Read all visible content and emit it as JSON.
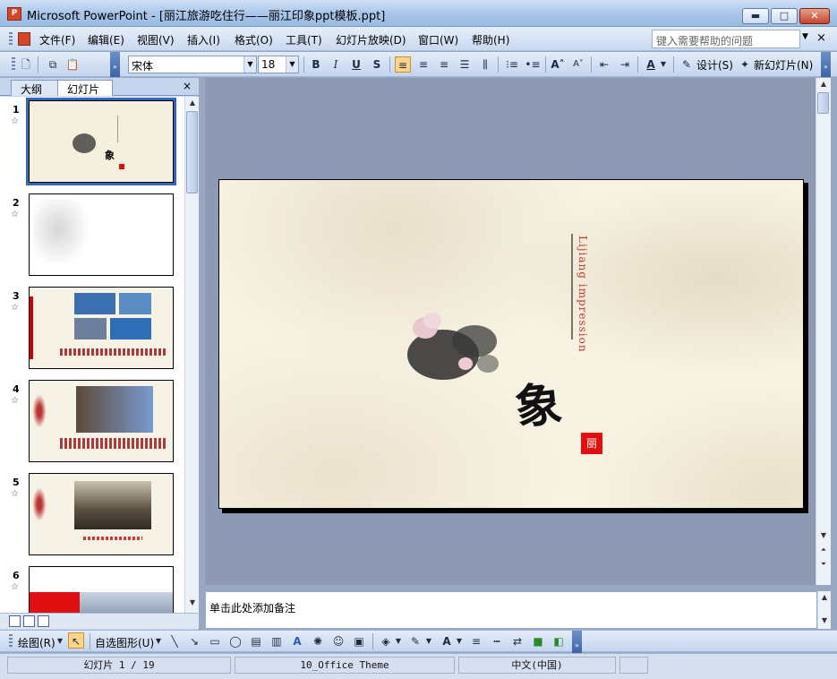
{
  "window": {
    "title": "Microsoft PowerPoint - [丽江旅游吃住行——丽江印象ppt模板.ppt]",
    "app_icon": "P",
    "buttons": {
      "minimize": "▬",
      "maximize": "□",
      "close": "✕"
    }
  },
  "menu": {
    "items": [
      "文件(F)",
      "编辑(E)",
      "视图(V)",
      "插入(I)",
      "格式(O)",
      "工具(T)",
      "幻灯片放映(D)",
      "窗口(W)",
      "帮助(H)"
    ],
    "help_placeholder": "键入需要帮助的问题",
    "close_doc": "×"
  },
  "toolbar": {
    "font_name": "宋体",
    "font_size": "18",
    "bold": "B",
    "italic": "I",
    "underline": "U",
    "shadow": "S",
    "design_label": "设计(S)",
    "new_slide_label": "新幻灯片(N)"
  },
  "left_panel": {
    "tab_outline": "大纲",
    "tab_slides": "幻灯片",
    "close": "×",
    "slides": [
      {
        "num": "1",
        "selected": true
      },
      {
        "num": "2",
        "selected": false
      },
      {
        "num": "3",
        "selected": false
      },
      {
        "num": "4",
        "selected": false
      },
      {
        "num": "5",
        "selected": false
      },
      {
        "num": "6",
        "selected": false
      }
    ]
  },
  "slide": {
    "vertical_text": "Lijiang impression",
    "calligraphy": "象",
    "seal_text": "丽"
  },
  "notes": {
    "placeholder": "单击此处添加备注"
  },
  "drawbar": {
    "draw_label": "绘图(R)",
    "autoshapes_label": "自选图形(U)"
  },
  "status": {
    "slide_info": "幻灯片 1 / 19",
    "theme": "10_Office Theme",
    "language": "中文(中国)"
  },
  "colors": {
    "accent_red": "#e01010",
    "text_red": "#c0392b",
    "selection_blue": "#3564b8"
  }
}
